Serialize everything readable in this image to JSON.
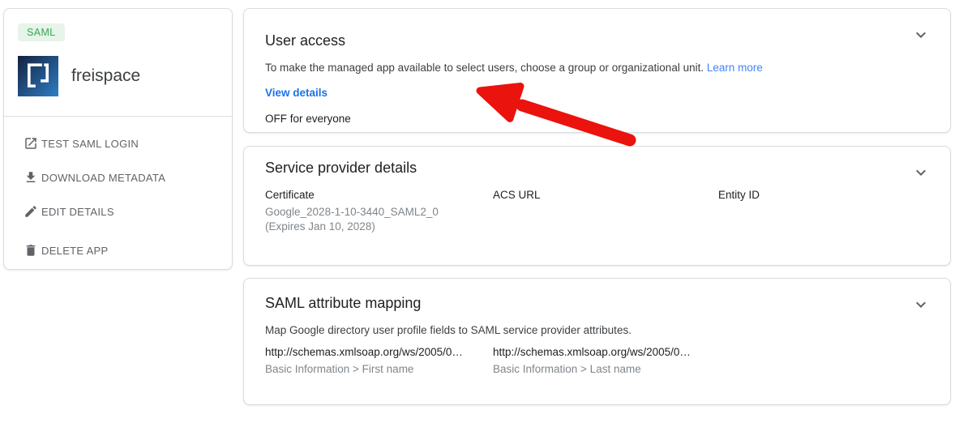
{
  "app_card": {
    "badge": "SAML",
    "app_name": "freispace",
    "actions": [
      {
        "icon": "open-in-new",
        "label": "TEST SAML LOGIN"
      },
      {
        "icon": "download",
        "label": "DOWNLOAD METADATA"
      },
      {
        "icon": "pencil",
        "label": "EDIT DETAILS"
      },
      {
        "icon": "trash",
        "label": "DELETE APP"
      }
    ]
  },
  "cards": {
    "user_access": {
      "title": "User access",
      "description": "To make the managed app available to select users, choose a group or organizational unit.",
      "learn_more_label": "Learn more",
      "view_details_label": "View details",
      "status": "OFF for everyone"
    },
    "service_provider": {
      "title": "Service provider details",
      "columns": [
        {
          "header": "Certificate",
          "line1": "Google_2028-1-10-3440_SAML2_0",
          "line2": "(Expires Jan 10, 2028)"
        },
        {
          "header": "ACS URL"
        },
        {
          "header": "Entity ID"
        }
      ]
    },
    "attribute_mapping": {
      "title": "SAML attribute mapping",
      "description": "Map Google directory user profile fields to SAML service provider attributes.",
      "mappings": [
        {
          "attribute": "http://schemas.xmlsoap.org/ws/2005/0…",
          "field": "Basic Information > First name"
        },
        {
          "attribute": "http://schemas.xmlsoap.org/ws/2005/0…",
          "field": "Basic Information > Last name"
        }
      ]
    }
  },
  "colors": {
    "view_details_blue": "#1a73e8",
    "learn_more_blue": "#4285f4",
    "badge_green": "#34a853",
    "badge_background": "#e6f4ea",
    "arrow_red": "#ea130d",
    "text_primary": "#202124",
    "text_secondary": "#5f6368",
    "text_hint": "#80868b",
    "card_border": "#dadce0"
  }
}
